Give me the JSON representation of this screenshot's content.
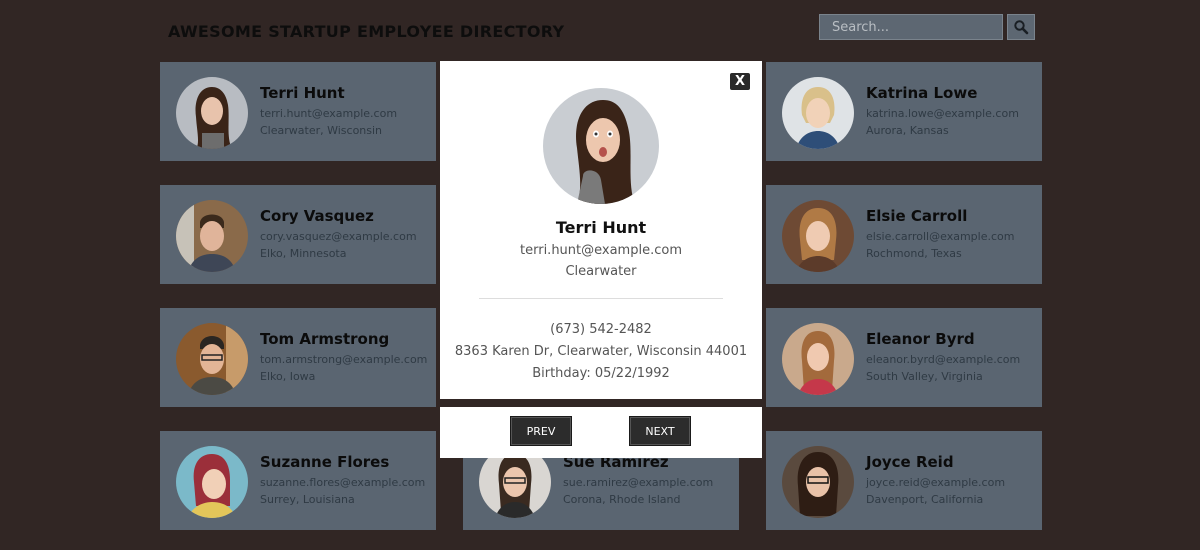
{
  "header": {
    "title": "AWESOME STARTUP EMPLOYEE DIRECTORY",
    "search_placeholder": "Search...",
    "search_icon": "magnifier-icon"
  },
  "employees": [
    {
      "name": "Terri Hunt",
      "email": "terri.hunt@example.com",
      "location": "Clearwater, Wisconsin"
    },
    {
      "name": "Katrina Lowe",
      "email": "katrina.lowe@example.com",
      "location": "Aurora, Kansas"
    },
    {
      "name": "Cory Vasquez",
      "email": "cory.vasquez@example.com",
      "location": "Elko, Minnesota"
    },
    {
      "name": "Elsie Carroll",
      "email": "elsie.carroll@example.com",
      "location": "Rochmond, Texas"
    },
    {
      "name": "Tom Armstrong",
      "email": "tom.armstrong@example.com",
      "location": "Elko, Iowa"
    },
    {
      "name": "Eleanor Byrd",
      "email": "eleanor.byrd@example.com",
      "location": "South Valley, Virginia"
    },
    {
      "name": "Suzanne Flores",
      "email": "suzanne.flores@example.com",
      "location": "Surrey, Louisiana"
    },
    {
      "name": "Sue Ramirez",
      "email": "sue.ramirez@example.com",
      "location": "Corona, Rhode Island"
    },
    {
      "name": "Joyce Reid",
      "email": "joyce.reid@example.com",
      "location": "Davenport, California"
    }
  ],
  "modal": {
    "close_label": "X",
    "name": "Terri Hunt",
    "email": "terri.hunt@example.com",
    "city": "Clearwater",
    "phone": "(673) 542-2482",
    "address": "8363 Karen Dr, Clearwater, Wisconsin 44001",
    "birthday": "Birthday: 05/22/1992",
    "prev_label": "PREV",
    "next_label": "NEXT"
  },
  "colors": {
    "background": "#312624",
    "card": "#5a6571",
    "modal": "#ffffff",
    "button": "#2c2c2c"
  }
}
